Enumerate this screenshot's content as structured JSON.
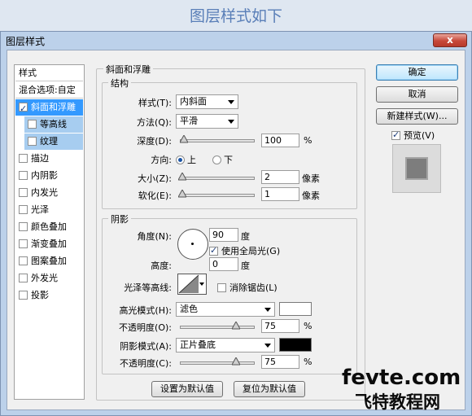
{
  "caption": "图层样式如下",
  "window": {
    "title": "图层样式",
    "close": "x"
  },
  "sidebar": {
    "header": "样式",
    "blend": "混合选项:自定",
    "items": [
      {
        "label": "斜面和浮雕",
        "checked": true
      },
      {
        "label": "等高线",
        "checked": false
      },
      {
        "label": "纹理",
        "checked": false
      },
      {
        "label": "描边",
        "checked": false
      },
      {
        "label": "内阴影",
        "checked": false
      },
      {
        "label": "内发光",
        "checked": false
      },
      {
        "label": "光泽",
        "checked": false
      },
      {
        "label": "颜色叠加",
        "checked": false
      },
      {
        "label": "渐变叠加",
        "checked": false
      },
      {
        "label": "图案叠加",
        "checked": false
      },
      {
        "label": "外发光",
        "checked": false
      },
      {
        "label": "投影",
        "checked": false
      }
    ]
  },
  "bevel": {
    "group": "斜面和浮雕",
    "structure": {
      "group": "结构",
      "style_label": "样式(T):",
      "style_value": "内斜面",
      "method_label": "方法(Q):",
      "method_value": "平滑",
      "depth_label": "深度(D):",
      "depth_value": "100",
      "depth_unit": "%",
      "depth_frac": 0.04,
      "direction_label": "方向:",
      "dir_up": "上",
      "dir_down": "下",
      "size_label": "大小(Z):",
      "size_value": "2",
      "size_unit": "像素",
      "size_frac": 0.02,
      "soften_label": "软化(E):",
      "soften_value": "1",
      "soften_unit": "像素",
      "soften_frac": 0.02
    },
    "shading": {
      "group": "阴影",
      "angle_label": "角度(N):",
      "angle_value": "90",
      "angle_unit": "度",
      "global_light": "使用全局光(G)",
      "altitude_label": "高度:",
      "altitude_value": "0",
      "altitude_unit": "度",
      "gloss_label": "光泽等高线:",
      "antialias": "消除锯齿(L)",
      "highlight_label": "高光模式(H):",
      "highlight_mode": "滤色",
      "highlight_color": "#ffffff",
      "hl_opacity_label": "不透明度(O):",
      "hl_opacity_value": "75",
      "hl_opacity_unit": "%",
      "hl_opacity_frac": 0.75,
      "shadow_label": "阴影模式(A):",
      "shadow_mode": "正片叠底",
      "shadow_color": "#000000",
      "sh_opacity_label": "不透明度(C):",
      "sh_opacity_value": "75",
      "sh_opacity_unit": "%",
      "sh_opacity_frac": 0.75
    },
    "make_default": "设置为默认值",
    "reset_default": "复位为默认值"
  },
  "actions": {
    "ok": "确定",
    "cancel": "取消",
    "new_style": "新建样式(W)...",
    "preview": "预览(V)"
  },
  "watermark": {
    "line1": "fevte.com",
    "line2": "飞特教程网"
  }
}
